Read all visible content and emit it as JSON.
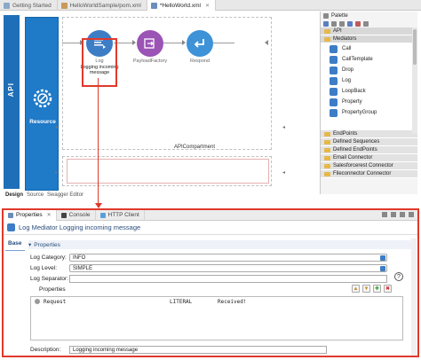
{
  "tabs": [
    {
      "label": "Getting Started",
      "close": "",
      "active": false
    },
    {
      "label": "HelloWorldSample/pom.xml",
      "close": "",
      "active": false
    },
    {
      "label": "*HelloWorld.xml",
      "close": "✕",
      "active": true
    }
  ],
  "editor": {
    "api_label": "API",
    "resource_label": "Resource",
    "nodes": [
      {
        "name": "log-node",
        "label": "Log",
        "sublabel": "Logging incoming message"
      },
      {
        "name": "faultformat-node",
        "label": "PayloadFactory",
        "sublabel": ""
      },
      {
        "name": "respond-node",
        "label": "Respond",
        "sublabel": ""
      }
    ],
    "compartment_label": "APICompartment",
    "bottom_tabs": [
      "Design",
      "Source",
      "Swagger Editor"
    ]
  },
  "palette": {
    "title": "Palette",
    "api_category": "API",
    "mediators_category": "Mediators",
    "mediators": [
      "Call",
      "CallTemplate",
      "Drop",
      "Log",
      "LoopBack",
      "Property",
      "PropertyGroup"
    ],
    "categories": [
      "EndPoints",
      "Defined Sequences",
      "Defined EndPoints",
      "Email Connector",
      "Salesforcerest Connector",
      "Fileconnector Connector"
    ]
  },
  "properties": {
    "tabs": [
      {
        "label": "Properties",
        "active": true
      },
      {
        "label": "Console",
        "active": false
      },
      {
        "label": "HTTP Client",
        "active": false
      }
    ],
    "title": "Log Mediator Logging incoming message",
    "base_tab": "Base",
    "section": "Properties",
    "log_category_label": "Log Category:",
    "log_category_value": "INFO",
    "log_level_label": "Log Level:",
    "log_level_value": "SIMPLE",
    "log_separator_label": "Log Separator:",
    "log_separator_value": "",
    "sub_properties_label": "Properties",
    "rows": [
      {
        "name": "Request",
        "type": "LITERAL",
        "value": "Received!"
      }
    ],
    "description_label": "Description:",
    "description_value": "Logging incoming message"
  },
  "colors": {
    "accent_red": "#e0392b",
    "api_blue": "#1f6fb8",
    "log_blue": "#3d7dc6",
    "fault_purple": "#9b53b5"
  }
}
